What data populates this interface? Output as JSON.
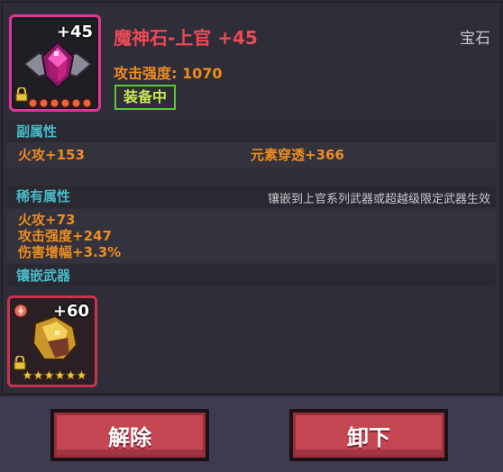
{
  "item": {
    "level_badge": "+45",
    "name": "魔神石-上官 +45",
    "type": "宝石",
    "attack_strength": "攻击强度: 1070",
    "equipped": "装备中",
    "star_count": 5
  },
  "sections": {
    "secondary_title": "副属性",
    "secondary_stats": [
      "火攻+153",
      "元素穿透+366"
    ],
    "rare_title": "稀有属性",
    "rare_note": "镶嵌到上官系列武器或超越级限定武器生效",
    "rare_stats": [
      "火攻+73",
      "攻击强度+247",
      "伤害增幅+3.3%"
    ],
    "weapon_title": "镶嵌武器"
  },
  "weapon": {
    "level_badge": "+60",
    "star_count": 5
  },
  "buttons": {
    "unequip": "解除",
    "remove": "卸下"
  },
  "colors": {
    "title": "#ec4a55",
    "stat": "#ee8d1f",
    "section": "#48b9c9",
    "equipped": "#59c83a",
    "button": "#c54653"
  }
}
